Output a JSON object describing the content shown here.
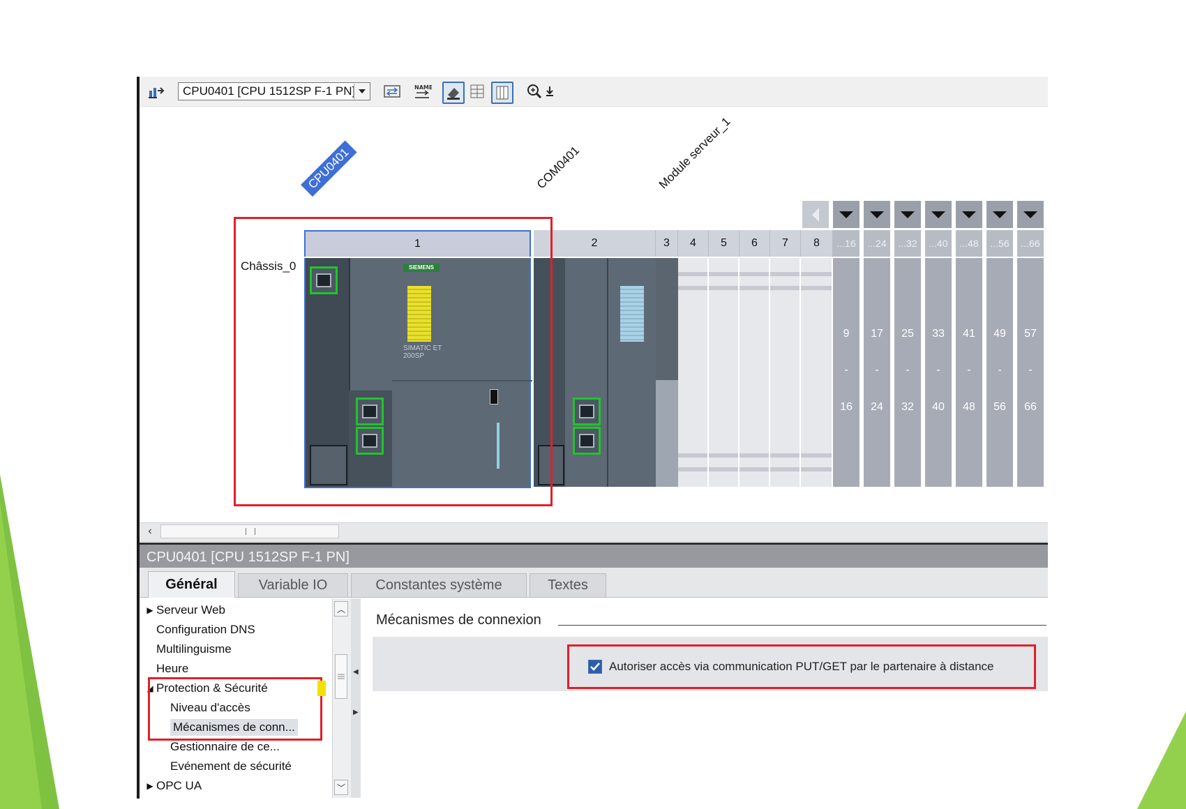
{
  "toolbar": {
    "device_select": "CPU0401 [CPU 1512SP F-1 PN]",
    "icons": [
      "network-icon",
      "dropdown-arrow-icon",
      "swap-icon",
      "rename-icon",
      "topology-view-icon",
      "grid-view-icon",
      "columns-view-icon",
      "zoom-icon",
      "download-icon"
    ]
  },
  "canvas": {
    "device_labels": [
      "CPU0401",
      "COM0401",
      "Module serveur_1"
    ],
    "rack_label": "Châssis_0",
    "module_brand": "SIEMENS",
    "module_text": "SIMATIC ET 200SP",
    "slot_numbers": [
      "1",
      "2",
      "3",
      "4",
      "5",
      "6",
      "7",
      "8"
    ],
    "group_headers": [
      "...16",
      "...24",
      "...32",
      "...40",
      "...48",
      "...56",
      "...66"
    ],
    "group_starts": [
      "9",
      "17",
      "25",
      "33",
      "41",
      "49",
      "57"
    ],
    "group_dash": "-",
    "group_ends": [
      "16",
      "24",
      "32",
      "40",
      "48",
      "56",
      "66"
    ]
  },
  "properties": {
    "title": "CPU0401 [CPU 1512SP F-1 PN]",
    "tabs": [
      "Général",
      "Variable IO",
      "Constantes système",
      "Textes"
    ],
    "tree": [
      {
        "label": "Serveur Web",
        "caret": "▶",
        "indent": 0
      },
      {
        "label": "Configuration DNS",
        "caret": "",
        "indent": 0
      },
      {
        "label": "Multilinguisme",
        "caret": "",
        "indent": 0
      },
      {
        "label": "Heure",
        "caret": "",
        "indent": 0
      },
      {
        "label": "Protection & Sécurité",
        "caret": "◢",
        "indent": 0
      },
      {
        "label": "Niveau d'accès",
        "caret": "",
        "indent": 1
      },
      {
        "label": "Mécanismes de conn...",
        "caret": "",
        "indent": 1,
        "selected": true
      },
      {
        "label": "Gestionnaire de ce...",
        "caret": "",
        "indent": 1
      },
      {
        "label": "Evénement de sécurité",
        "caret": "",
        "indent": 1
      },
      {
        "label": "OPC UA",
        "caret": "▶",
        "indent": 0
      }
    ],
    "section_title": "Mécanismes de connexion",
    "checkbox_label": "Autoriser accès via communication PUT/GET par le partenaire à distance",
    "checkbox_checked": true
  },
  "colors": {
    "highlight_red": "#e0202a",
    "port_green": "#22c32a",
    "selection_blue": "#3d6fd6",
    "slide_green": "#8fce3c"
  }
}
